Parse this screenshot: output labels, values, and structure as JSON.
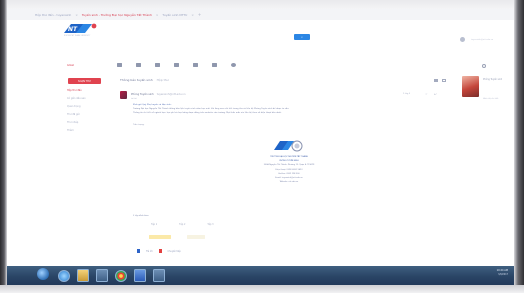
{
  "browser": {
    "tabs": [
      {
        "label": "Hộp thư đến - tuyensinh",
        "active": false
      },
      {
        "label": "Tuyển sinh - Trường Đại học Nguyễn Tất Thành",
        "active": true
      },
      {
        "label": "Tuyển sinh NTTU",
        "active": false
      }
    ],
    "new_tab_glyph": "+"
  },
  "header": {
    "logo_caption": "NGUYEN TAT THANH UNIVERSITY",
    "account_text": "tuyensinh@ntt.edu.vn"
  },
  "toolbar": {
    "mail_label": "Gmail"
  },
  "sidebar": {
    "compose_label": "SOẠN THƯ",
    "items": [
      {
        "label": "Hộp thư đến",
        "active": true
      },
      {
        "label": "Có gắn dấu sao",
        "active": false
      },
      {
        "label": "Quan trọng",
        "active": false
      },
      {
        "label": "Thư đã gửi",
        "active": false
      },
      {
        "label": "Thư nháp",
        "active": false
      },
      {
        "label": "Thêm",
        "active": false
      }
    ]
  },
  "message": {
    "subject": "Thông báo tuyển sinh",
    "subject_tag": "Hộp thư",
    "sender_name": "Phòng Tuyển sinh",
    "sender_address": "tuyensinh@ntt.edu.vn",
    "to": "tới tôi",
    "date": "9 thg 3",
    "body": [
      "Kính gửi Quý Phụ huynh và Học sinh,",
      "Trường Đại học Nguyễn Tất Thành thông báo lịch tuyển sinh năm học mới. Vui lòng xem chi tiết trong thư và liên hệ Phòng Tuyển sinh để được tư vấn.",
      "Thông tin chi tiết về ngành học, học phí và học bổng được đăng trên website của trường. Mọi thắc mắc xin liên hệ theo số điện thoại bên dưới."
    ],
    "signoff": "Trân trọng,",
    "signature": [
      "TRƯỜNG ĐẠI HỌC NGUYỄN TẤT THÀNH",
      "PHÒNG TUYỂN SINH",
      "300A Nguyễn Tất Thành, Phường 13, Quận 4, TP.HCM",
      "Điện thoại: (028) 6261 9423",
      "Hotline: 0902 298 300",
      "Email: tuyensinh@ntt.edu.vn",
      "Website: ntt.edu.vn"
    ]
  },
  "attachments": {
    "title": "2 tệp đính kèm",
    "items": [
      "Tệp 1",
      "Tệp 2",
      "Tệp 3"
    ]
  },
  "reply_links": {
    "reply": "Trả lời",
    "forward": "Chuyển tiếp"
  },
  "contact_panel": {
    "name": "Phòng Tuyển sinh",
    "sub": "Hiển thị chi tiết"
  },
  "taskbar": {
    "time": "10:24 AM",
    "date": "3/9/2017"
  },
  "colors": {
    "accent_red": "#e0434f",
    "search_blue": "#2b86e4",
    "taskbar": "#2a4566"
  }
}
